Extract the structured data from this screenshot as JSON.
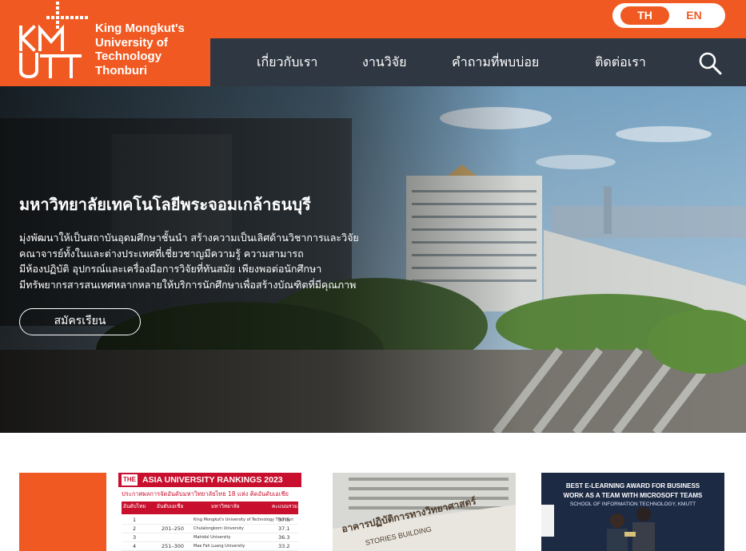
{
  "brand": {
    "logo_mark": "KMUTT",
    "name_lines": [
      "King Mongkut's",
      "University of",
      "Technology",
      "Thonburi"
    ],
    "orange": "#f05a22",
    "nav_bg": "#2f3742"
  },
  "lang": {
    "th": "TH",
    "en": "EN",
    "active": "TH"
  },
  "nav": {
    "items": [
      {
        "label": "เกี่ยวกับเรา"
      },
      {
        "label": "งานวิจัย"
      },
      {
        "label": "คำถามที่พบบ่อย"
      },
      {
        "label": "ติดต่อเรา"
      }
    ],
    "search_icon": "search-icon"
  },
  "hero": {
    "title": "มหาวิทยาลัยเทคโนโลยีพระจอมเกล้าธนบุรี",
    "description_lines": [
      "มุ่งพัฒนาให้เป็นสถาบันอุดมศึกษาชั้นนำ สร้างความเป็นเลิศด้านวิชาการและวิจัย",
      "คณาจารย์ทั้งในและต่างประเทศที่เชี่ยวชาญมีความรู้ ความสามารถ",
      "มีห้องปฏิบัติ อุปกรณ์และเครื่องมือการวิจัยที่ทันสมัย เพียงพอต่อนักศึกษา",
      "มีทรัพยากรสารสนเทศหลากหลายให้บริการนักศึกษาเพื่อสร้างบัณฑิตที่มีคุณภาพ"
    ],
    "apply_label": "สมัครเรียน"
  },
  "news": {
    "card1": {
      "logo": "THE",
      "title": "ASIA UNIVERSITY RANKINGS 2023",
      "subtitle": "ประกาศผลการจัดอันดับมหาวิทยาลัยไทย 18 แห่ง ติดอันดับเอเชีย",
      "headers": [
        "อันดับไทย",
        "อันดับเอเชีย",
        "มหาวิทยาลัย",
        "คะแนนรวม"
      ],
      "rows": [
        {
          "th": "1",
          "asia": "",
          "uni": "King Mongkut's University of Technology Thonburi",
          "score": "37.5"
        },
        {
          "th": "2",
          "asia": "201–250",
          "uni": "Chulalongkorn University",
          "score": "37.1"
        },
        {
          "th": "3",
          "asia": "",
          "uni": "Mahidol University",
          "score": "36.3"
        },
        {
          "th": "4",
          "asia": "251–300",
          "uni": "Mae Fah Luang University",
          "score": "33.2"
        }
      ]
    },
    "card2": {
      "text": "อาคารปฏิบัติการทางวิทยาศาสตร์",
      "text_en": "STORIES BUILDING"
    },
    "card3": {
      "line1": "BEST E-LEARNING AWARD FOR BUSINESS",
      "line2": "WORK AS A TEAM WITH MICROSOFT TEAMS",
      "line3": "SCHOOL OF INFORMATION TECHNOLOGY, KMUTT"
    }
  }
}
